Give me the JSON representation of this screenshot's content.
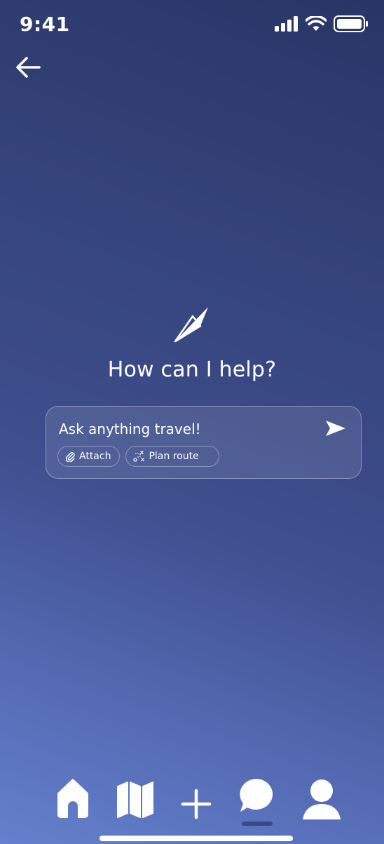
{
  "status": {
    "time": "9:41"
  },
  "assistant": {
    "title": "How can I help?",
    "input_placeholder": "Ask anything travel!",
    "chips": [
      {
        "label": "Attach",
        "icon": "paperclip-icon"
      },
      {
        "label": "Plan route",
        "icon": "route-icon"
      }
    ]
  },
  "nav": {
    "items": [
      "home-icon",
      "map-icon",
      "plus-icon",
      "chat-icon",
      "profile-icon"
    ],
    "active": "chat-icon"
  },
  "colors": {
    "bg_top": "#283566",
    "bg_bottom": "#6580cc",
    "foreground": "#ffffff"
  }
}
